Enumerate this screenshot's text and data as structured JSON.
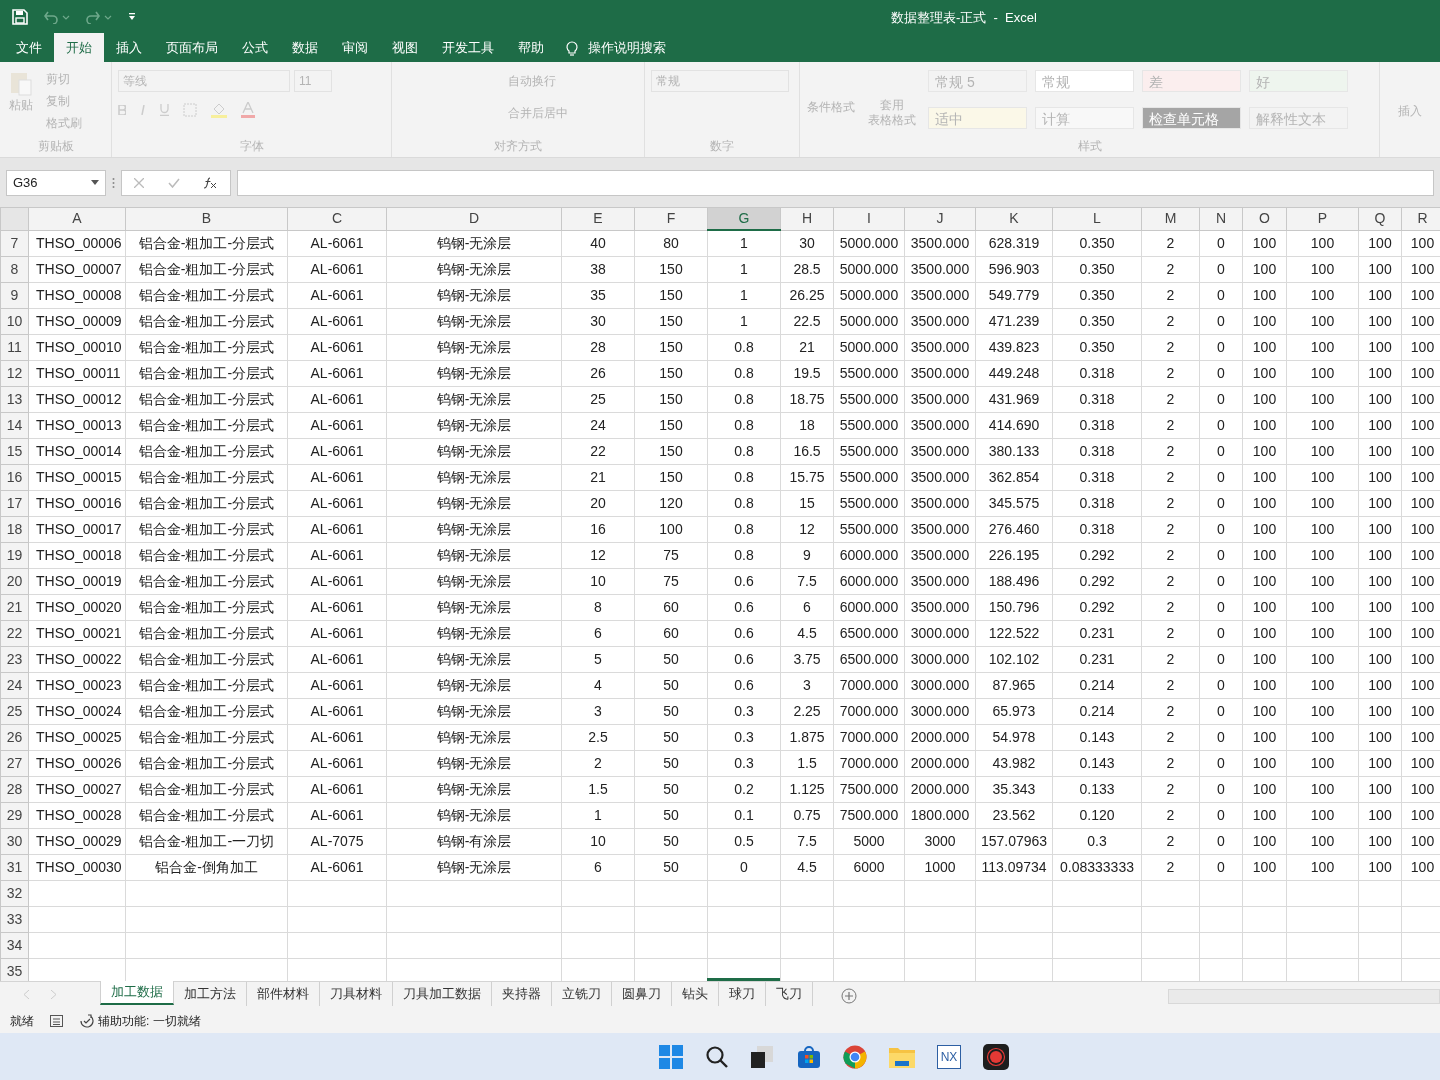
{
  "window": {
    "title": "数据整理表-正式  -  Excel"
  },
  "menu": [
    {
      "label": "文件",
      "selected": false
    },
    {
      "label": "开始",
      "selected": true
    },
    {
      "label": "插入",
      "selected": false
    },
    {
      "label": "页面布局",
      "selected": false
    },
    {
      "label": "公式",
      "selected": false
    },
    {
      "label": "数据",
      "selected": false
    },
    {
      "label": "审阅",
      "selected": false
    },
    {
      "label": "视图",
      "selected": false
    },
    {
      "label": "开发工具",
      "selected": false
    },
    {
      "label": "帮助",
      "selected": false
    }
  ],
  "tell_me": "操作说明搜索",
  "ribbon": {
    "disabled": true,
    "clipboard": {
      "paste": "粘贴",
      "items": [
        "剪切",
        "复制",
        "格式刷"
      ],
      "label": "剪贴板"
    },
    "font": {
      "font_name": "等线",
      "font_size": "11",
      "label": "字体"
    },
    "alignment": {
      "wrap": "自动换行",
      "merge": "合并后居中",
      "label": "对齐方式"
    },
    "number": {
      "format": "常规",
      "label": "数字"
    },
    "styles": {
      "conditional": "条件格式",
      "table": [
        "套用",
        "表格格式"
      ],
      "cells": [
        {
          "label": "常规 5",
          "color": "#f3f3f3"
        },
        {
          "label": "常规",
          "color": "#ffffff"
        },
        {
          "label": "差",
          "color": "#fbeeee"
        },
        {
          "label": "好",
          "color": "#eef5ee"
        },
        {
          "label": "适中",
          "color": "#fbf8e8"
        },
        {
          "label": "计算",
          "color": "#f8f8f8"
        },
        {
          "label": "检查单元格",
          "color": "#a5a5a5"
        },
        {
          "label": "解释性文本",
          "color": "#f3f3f3"
        }
      ],
      "label": "样式"
    },
    "insert": "插入"
  },
  "name_box": "G36",
  "columns": [
    {
      "label": "A",
      "selected": false
    },
    {
      "label": "B",
      "selected": false
    },
    {
      "label": "C",
      "selected": false
    },
    {
      "label": "D",
      "selected": false
    },
    {
      "label": "E",
      "selected": false
    },
    {
      "label": "F",
      "selected": false
    },
    {
      "label": "G",
      "selected": true
    },
    {
      "label": "H",
      "selected": false
    },
    {
      "label": "I",
      "selected": false
    },
    {
      "label": "J",
      "selected": false
    },
    {
      "label": "K",
      "selected": false
    },
    {
      "label": "L",
      "selected": false
    },
    {
      "label": "M",
      "selected": false
    },
    {
      "label": "N",
      "selected": false
    },
    {
      "label": "O",
      "selected": false
    },
    {
      "label": "P",
      "selected": false
    },
    {
      "label": "Q",
      "selected": false
    },
    {
      "label": "R",
      "selected": false
    }
  ],
  "rows": [
    {
      "num": "7",
      "cells": [
        "THSO_00006",
        "铝合金-粗加工-分层式",
        "AL-6061",
        "钨钢-无涂层",
        "40",
        "80",
        "1",
        "30",
        "5000.000",
        "3500.000",
        "628.319",
        "0.350",
        "2",
        "0",
        "100",
        "100",
        "100",
        "100"
      ]
    },
    {
      "num": "8",
      "cells": [
        "THSO_00007",
        "铝合金-粗加工-分层式",
        "AL-6061",
        "钨钢-无涂层",
        "38",
        "150",
        "1",
        "28.5",
        "5000.000",
        "3500.000",
        "596.903",
        "0.350",
        "2",
        "0",
        "100",
        "100",
        "100",
        "100"
      ]
    },
    {
      "num": "9",
      "cells": [
        "THSO_00008",
        "铝合金-粗加工-分层式",
        "AL-6061",
        "钨钢-无涂层",
        "35",
        "150",
        "1",
        "26.25",
        "5000.000",
        "3500.000",
        "549.779",
        "0.350",
        "2",
        "0",
        "100",
        "100",
        "100",
        "100"
      ]
    },
    {
      "num": "10",
      "cells": [
        "THSO_00009",
        "铝合金-粗加工-分层式",
        "AL-6061",
        "钨钢-无涂层",
        "30",
        "150",
        "1",
        "22.5",
        "5000.000",
        "3500.000",
        "471.239",
        "0.350",
        "2",
        "0",
        "100",
        "100",
        "100",
        "100"
      ]
    },
    {
      "num": "11",
      "cells": [
        "THSO_00010",
        "铝合金-粗加工-分层式",
        "AL-6061",
        "钨钢-无涂层",
        "28",
        "150",
        "0.8",
        "21",
        "5000.000",
        "3500.000",
        "439.823",
        "0.350",
        "2",
        "0",
        "100",
        "100",
        "100",
        "100"
      ]
    },
    {
      "num": "12",
      "cells": [
        "THSO_00011",
        "铝合金-粗加工-分层式",
        "AL-6061",
        "钨钢-无涂层",
        "26",
        "150",
        "0.8",
        "19.5",
        "5500.000",
        "3500.000",
        "449.248",
        "0.318",
        "2",
        "0",
        "100",
        "100",
        "100",
        "100"
      ]
    },
    {
      "num": "13",
      "cells": [
        "THSO_00012",
        "铝合金-粗加工-分层式",
        "AL-6061",
        "钨钢-无涂层",
        "25",
        "150",
        "0.8",
        "18.75",
        "5500.000",
        "3500.000",
        "431.969",
        "0.318",
        "2",
        "0",
        "100",
        "100",
        "100",
        "100"
      ]
    },
    {
      "num": "14",
      "cells": [
        "THSO_00013",
        "铝合金-粗加工-分层式",
        "AL-6061",
        "钨钢-无涂层",
        "24",
        "150",
        "0.8",
        "18",
        "5500.000",
        "3500.000",
        "414.690",
        "0.318",
        "2",
        "0",
        "100",
        "100",
        "100",
        "100"
      ]
    },
    {
      "num": "15",
      "cells": [
        "THSO_00014",
        "铝合金-粗加工-分层式",
        "AL-6061",
        "钨钢-无涂层",
        "22",
        "150",
        "0.8",
        "16.5",
        "5500.000",
        "3500.000",
        "380.133",
        "0.318",
        "2",
        "0",
        "100",
        "100",
        "100",
        "100"
      ]
    },
    {
      "num": "16",
      "cells": [
        "THSO_00015",
        "铝合金-粗加工-分层式",
        "AL-6061",
        "钨钢-无涂层",
        "21",
        "150",
        "0.8",
        "15.75",
        "5500.000",
        "3500.000",
        "362.854",
        "0.318",
        "2",
        "0",
        "100",
        "100",
        "100",
        "100"
      ]
    },
    {
      "num": "17",
      "cells": [
        "THSO_00016",
        "铝合金-粗加工-分层式",
        "AL-6061",
        "钨钢-无涂层",
        "20",
        "120",
        "0.8",
        "15",
        "5500.000",
        "3500.000",
        "345.575",
        "0.318",
        "2",
        "0",
        "100",
        "100",
        "100",
        "100"
      ]
    },
    {
      "num": "18",
      "cells": [
        "THSO_00017",
        "铝合金-粗加工-分层式",
        "AL-6061",
        "钨钢-无涂层",
        "16",
        "100",
        "0.8",
        "12",
        "5500.000",
        "3500.000",
        "276.460",
        "0.318",
        "2",
        "0",
        "100",
        "100",
        "100",
        "100"
      ]
    },
    {
      "num": "19",
      "cells": [
        "THSO_00018",
        "铝合金-粗加工-分层式",
        "AL-6061",
        "钨钢-无涂层",
        "12",
        "75",
        "0.8",
        "9",
        "6000.000",
        "3500.000",
        "226.195",
        "0.292",
        "2",
        "0",
        "100",
        "100",
        "100",
        "100"
      ]
    },
    {
      "num": "20",
      "cells": [
        "THSO_00019",
        "铝合金-粗加工-分层式",
        "AL-6061",
        "钨钢-无涂层",
        "10",
        "75",
        "0.6",
        "7.5",
        "6000.000",
        "3500.000",
        "188.496",
        "0.292",
        "2",
        "0",
        "100",
        "100",
        "100",
        "100"
      ]
    },
    {
      "num": "21",
      "cells": [
        "THSO_00020",
        "铝合金-粗加工-分层式",
        "AL-6061",
        "钨钢-无涂层",
        "8",
        "60",
        "0.6",
        "6",
        "6000.000",
        "3500.000",
        "150.796",
        "0.292",
        "2",
        "0",
        "100",
        "100",
        "100",
        "100"
      ]
    },
    {
      "num": "22",
      "cells": [
        "THSO_00021",
        "铝合金-粗加工-分层式",
        "AL-6061",
        "钨钢-无涂层",
        "6",
        "60",
        "0.6",
        "4.5",
        "6500.000",
        "3000.000",
        "122.522",
        "0.231",
        "2",
        "0",
        "100",
        "100",
        "100",
        "100"
      ]
    },
    {
      "num": "23",
      "cells": [
        "THSO_00022",
        "铝合金-粗加工-分层式",
        "AL-6061",
        "钨钢-无涂层",
        "5",
        "50",
        "0.6",
        "3.75",
        "6500.000",
        "3000.000",
        "102.102",
        "0.231",
        "2",
        "0",
        "100",
        "100",
        "100",
        "100"
      ]
    },
    {
      "num": "24",
      "cells": [
        "THSO_00023",
        "铝合金-粗加工-分层式",
        "AL-6061",
        "钨钢-无涂层",
        "4",
        "50",
        "0.6",
        "3",
        "7000.000",
        "3000.000",
        "87.965",
        "0.214",
        "2",
        "0",
        "100",
        "100",
        "100",
        "100"
      ]
    },
    {
      "num": "25",
      "cells": [
        "THSO_00024",
        "铝合金-粗加工-分层式",
        "AL-6061",
        "钨钢-无涂层",
        "3",
        "50",
        "0.3",
        "2.25",
        "7000.000",
        "3000.000",
        "65.973",
        "0.214",
        "2",
        "0",
        "100",
        "100",
        "100",
        "100"
      ]
    },
    {
      "num": "26",
      "cells": [
        "THSO_00025",
        "铝合金-粗加工-分层式",
        "AL-6061",
        "钨钢-无涂层",
        "2.5",
        "50",
        "0.3",
        "1.875",
        "7000.000",
        "2000.000",
        "54.978",
        "0.143",
        "2",
        "0",
        "100",
        "100",
        "100",
        "100"
      ]
    },
    {
      "num": "27",
      "cells": [
        "THSO_00026",
        "铝合金-粗加工-分层式",
        "AL-6061",
        "钨钢-无涂层",
        "2",
        "50",
        "0.3",
        "1.5",
        "7000.000",
        "2000.000",
        "43.982",
        "0.143",
        "2",
        "0",
        "100",
        "100",
        "100",
        "100"
      ]
    },
    {
      "num": "28",
      "cells": [
        "THSO_00027",
        "铝合金-粗加工-分层式",
        "AL-6061",
        "钨钢-无涂层",
        "1.5",
        "50",
        "0.2",
        "1.125",
        "7500.000",
        "2000.000",
        "35.343",
        "0.133",
        "2",
        "0",
        "100",
        "100",
        "100",
        "100"
      ]
    },
    {
      "num": "29",
      "cells": [
        "THSO_00028",
        "铝合金-粗加工-分层式",
        "AL-6061",
        "钨钢-无涂层",
        "1",
        "50",
        "0.1",
        "0.75",
        "7500.000",
        "1800.000",
        "23.562",
        "0.120",
        "2",
        "0",
        "100",
        "100",
        "100",
        "100"
      ]
    },
    {
      "num": "30",
      "cells": [
        "THSO_00029",
        "铝合金-粗加工-一刀切",
        "AL-7075",
        "钨钢-有涂层",
        "10",
        "50",
        "0.5",
        "7.5",
        "5000",
        "3000",
        "157.07963",
        "0.3",
        "2",
        "0",
        "100",
        "100",
        "100",
        "100"
      ]
    },
    {
      "num": "31",
      "cells": [
        "THSO_00030",
        "铝合金-倒角加工",
        "AL-6061",
        "钨钢-无涂层",
        "6",
        "50",
        "0",
        "4.5",
        "6000",
        "1000",
        "113.09734",
        "0.08333333",
        "2",
        "0",
        "100",
        "100",
        "100",
        "100"
      ]
    },
    {
      "num": "32"
    },
    {
      "num": "33"
    },
    {
      "num": "34"
    },
    {
      "num": "35"
    }
  ],
  "sheets": [
    {
      "label": "加工数据",
      "selected": true
    },
    {
      "label": "加工方法",
      "selected": false
    },
    {
      "label": "部件材料",
      "selected": false
    },
    {
      "label": "刀具材料",
      "selected": false
    },
    {
      "label": "刀具加工数据",
      "selected": false
    },
    {
      "label": "夹持器",
      "selected": false
    },
    {
      "label": "立铣刀",
      "selected": false
    },
    {
      "label": "圆鼻刀",
      "selected": false
    },
    {
      "label": "钻头",
      "selected": false
    },
    {
      "label": "球刀",
      "selected": false
    },
    {
      "label": "飞刀",
      "selected": false
    }
  ],
  "status_bar": {
    "mode": "就绪",
    "accessibility": "辅助功能: 一切就绪"
  },
  "taskbar": {
    "nx_label": "NX"
  }
}
